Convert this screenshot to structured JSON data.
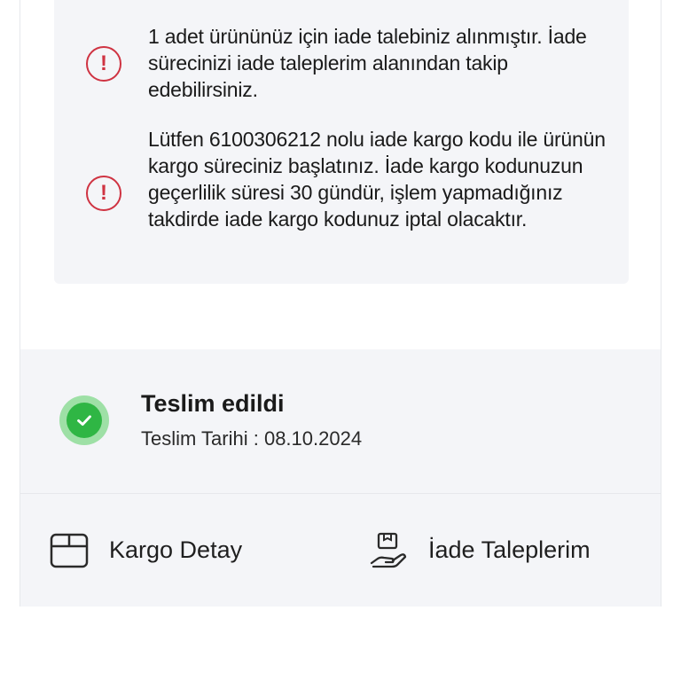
{
  "notices": [
    {
      "icon": "alert-circle-icon",
      "text": "1 adet ürününüz için iade talebiniz alınmıştır. İade sürecinizi iade taleplerim alanından takip edebilirsiniz."
    },
    {
      "icon": "alert-circle-icon",
      "text": "Lütfen 6100306212 nolu iade kargo kodu ile ürünün kargo süreciniz başlatınız. İade kargo kodunuzun geçerlilik süresi 30 gündür, işlem yapmadığınız takdirde iade kargo kodunuz iptal olacaktır."
    }
  ],
  "notice_symbol": "!",
  "delivery": {
    "status": "Teslim edildi",
    "date_label": "Teslim Tarihi : 08.10.2024"
  },
  "actions": {
    "cargo_detail": "Kargo Detay",
    "return_requests": "İade Taleplerim"
  },
  "colors": {
    "alert": "#cf3342",
    "success": "#2fb644",
    "panel": "#f4f5f8"
  }
}
